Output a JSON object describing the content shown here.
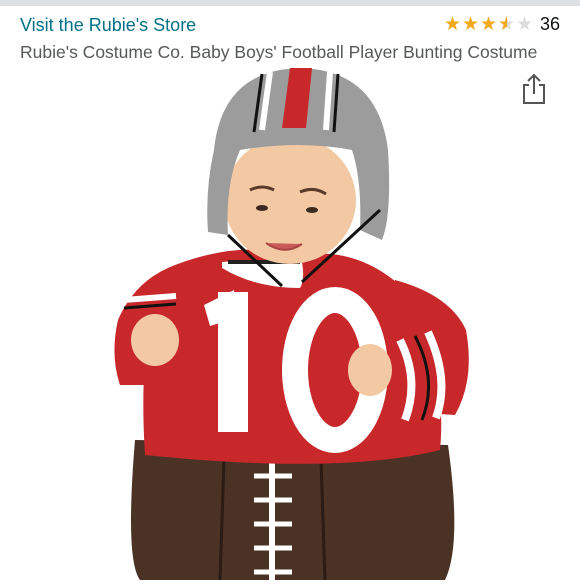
{
  "header": {
    "store_link": "Visit the Rubie's Store",
    "rating_stars": 3.5,
    "rating_max": 5,
    "rating_count": "36",
    "product_title": "Rubie's Costume Co. Baby Boys' Football Player Bunting Costume"
  },
  "icons": {
    "share": "share-icon",
    "star": "star-icon"
  },
  "colors": {
    "link": "#007185",
    "star": "#f2a91b",
    "title": "#565959",
    "jersey_red": "#c8282a",
    "football_brown": "#4a3225",
    "helmet_gray": "#9c9c9c"
  }
}
